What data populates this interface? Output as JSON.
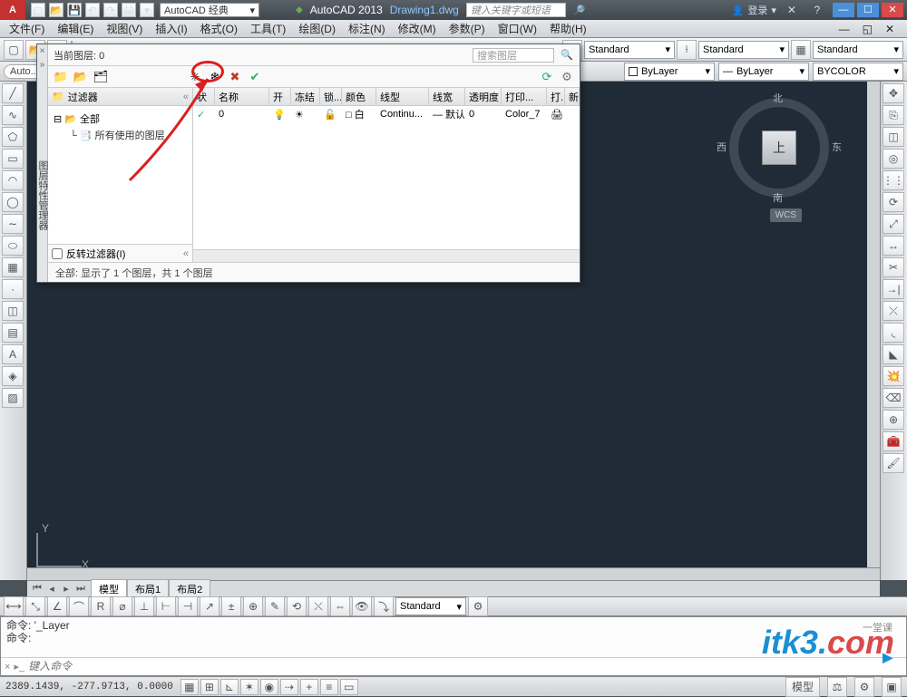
{
  "title": {
    "workspace": "AutoCAD 经典",
    "app": "AutoCAD 2013",
    "doc": "Drawing1.dwg",
    "search_hint": "键入关键字或短语",
    "login": "登录"
  },
  "menu": {
    "file": "文件(F)",
    "edit": "编辑(E)",
    "view": "视图(V)",
    "insert": "插入(I)",
    "format": "格式(O)",
    "tools": "工具(T)",
    "draw": "绘图(D)",
    "dimension": "标注(N)",
    "modify": "修改(M)",
    "param": "参数(P)",
    "window": "窗口(W)",
    "help": "帮助(H)"
  },
  "toolbar": {
    "std1": "Standard",
    "std2": "Standard",
    "std3": "Standard",
    "bylayer1": "ByLayer",
    "bylayer2": "ByLayer",
    "bycolor": "BYCOLOR",
    "auto_pill": "Auto..."
  },
  "viewcube": {
    "face": "上",
    "n": "北",
    "s": "南",
    "e": "东",
    "w": "西",
    "wcs": "WCS"
  },
  "axes": {
    "x": "X",
    "y": "Y"
  },
  "tabs": {
    "model": "模型",
    "layout1": "布局1",
    "layout2": "布局2"
  },
  "cmd": {
    "l1": "命令: '_Layer",
    "l2": "命令:",
    "hint": "键入命令",
    "prefix": "×"
  },
  "status": {
    "coords": "2389.1439, -277.9713, 0.0000",
    "model_btn": "模型"
  },
  "layer": {
    "current_label": "当前图层: 0",
    "search_hint": "搜索图层",
    "filter_header": "过滤器",
    "tree_all": "全部",
    "tree_used": "所有使用的图层",
    "invert": "反转过滤器(I)",
    "footer": "全部: 显示了 1 个图层，共 1 个图层",
    "cols": {
      "status": "状",
      "name": "名称",
      "on": "开",
      "freeze": "冻结",
      "lock": "锁...",
      "color": "颜色",
      "ltype": "线型",
      "lweight": "线宽",
      "trans": "透明度",
      "pstyle": "打印...",
      "plot": "打.",
      "new": "新."
    },
    "row0": {
      "status": "✓",
      "name": "0",
      "on": "💡",
      "freeze": "☀",
      "lock": "🔓",
      "color": "□ 白",
      "ltype": "Continu...",
      "lweight": "— 默认",
      "trans": "0",
      "pstyle": "Color_7",
      "plot": "🖨"
    },
    "vtitle": "图层特性管理器"
  },
  "bottom_tb": {
    "standard": "Standard"
  },
  "watermark": {
    "main": "itk3",
    "dot": ".",
    "com": "com",
    "sub1": "一堂课",
    "sub2": "▶"
  }
}
